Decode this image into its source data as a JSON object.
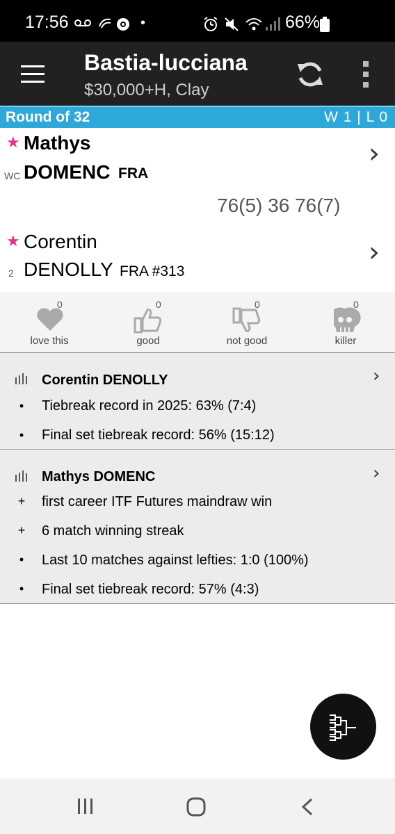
{
  "status_bar": {
    "time": "17:56",
    "battery": "66%"
  },
  "app_bar": {
    "title": "Bastia-lucciana",
    "subtitle": "$30,000+H, Clay"
  },
  "round": {
    "label": "Round of 32",
    "record": "W 1 | L 0"
  },
  "players": [
    {
      "first": "Mathys",
      "last": "DOMENC",
      "country": "FRA",
      "seed": "WC"
    },
    {
      "first": "Corentin",
      "last": "DENOLLY",
      "country": "FRA #313",
      "seed": "2"
    }
  ],
  "score": "76(5) 36 76(7)",
  "reactions": [
    {
      "label": "love this",
      "count": "0",
      "icon": "heart-icon"
    },
    {
      "label": "good",
      "count": "0",
      "icon": "thumbs-up-icon"
    },
    {
      "label": "not good",
      "count": "0",
      "icon": "thumbs-down-icon"
    },
    {
      "label": "killer",
      "count": "0",
      "icon": "skull-icon"
    }
  ],
  "insights": [
    {
      "player": "Corentin DENOLLY",
      "items": [
        {
          "bullet": "•",
          "text": "Tiebreak record in 2025: 63% (7:4)"
        },
        {
          "bullet": "•",
          "text": "Final set tiebreak record: 56% (15:12)"
        }
      ]
    },
    {
      "player": "Mathys DOMENC",
      "items": [
        {
          "bullet": "+",
          "text": "first career ITF Futures maindraw win"
        },
        {
          "bullet": "+",
          "text": "6 match winning streak"
        },
        {
          "bullet": "•",
          "text": "Last 10 matches against lefties: 1:0 (100%)"
        },
        {
          "bullet": "•",
          "text": "Final set tiebreak record: 57% (4:3)"
        }
      ]
    }
  ],
  "colors": {
    "accent": "#2ea8d8",
    "app_bar": "#212121",
    "star": "#e2328f"
  }
}
